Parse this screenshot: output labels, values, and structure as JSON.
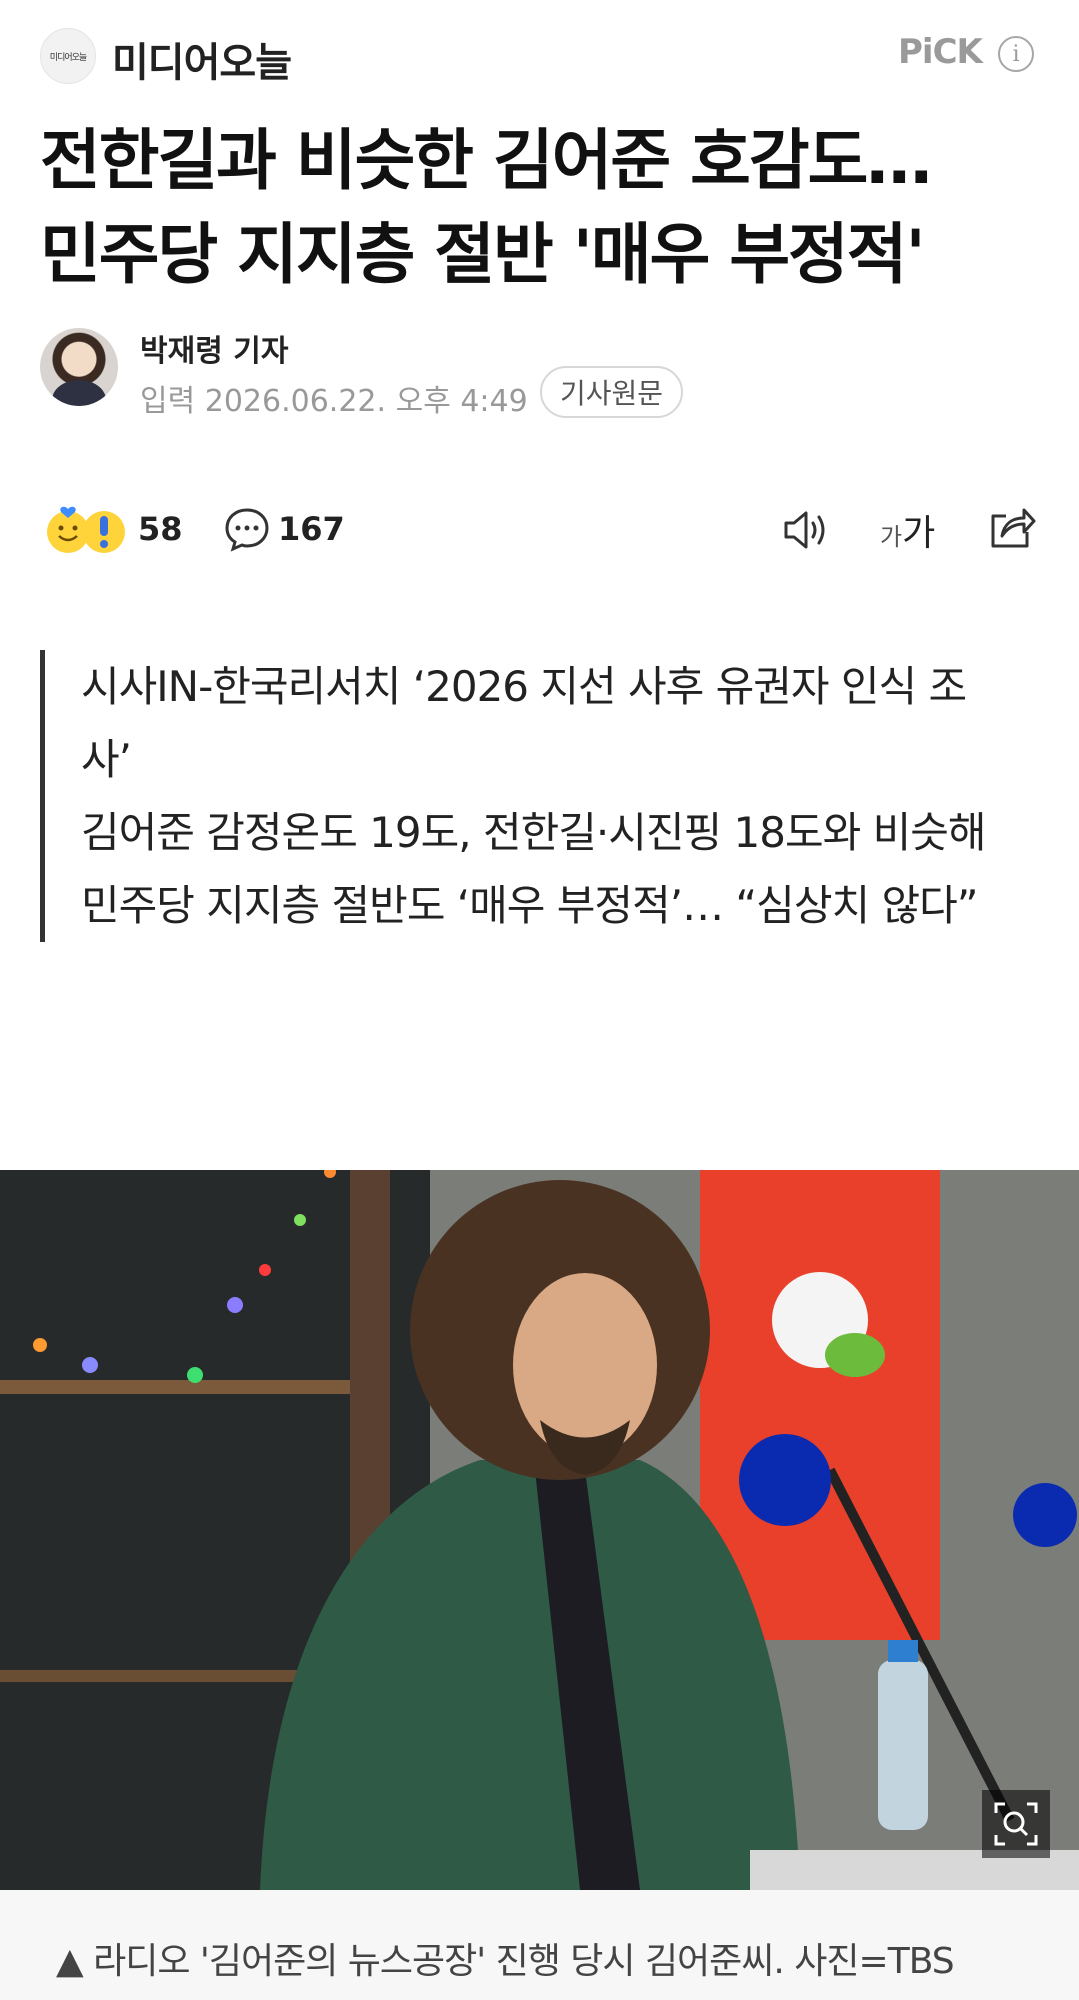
{
  "header": {
    "press_name": "미디어오늘",
    "press_logo_text": "미디어오늘",
    "pick_label": "PiCK",
    "info_symbol": "i"
  },
  "article": {
    "headline_line1": "전한길과 비슷한 김어준 호감도…",
    "headline_line2": "민주당 지지층 절반 '매우 부정적'",
    "reporter": "박재령 기자",
    "date_label": "입력",
    "date": "2026.06.22. 오후 4:49",
    "origin_label": "기사원문"
  },
  "toolbar": {
    "reaction_count": "58",
    "comment_count": "167",
    "font_size_small": "가",
    "font_size_large": "가"
  },
  "summary": [
    "시사IN-한국리서치 ‘2026 지선 사후 유권자 인식 조사’",
    "김어준 감정온도 19도, 전한길·시진핑 18도와 비슷해",
    "민주당 지지층 절반도 ‘매우 부정적’… “심상치 않다”"
  ],
  "photo": {
    "caption": "▲ 라디오 '김어준의 뉴스공장' 진행 당시 김어준씨. 사진=TBS"
  },
  "colors": {
    "mic": "#0a2bb0",
    "jacket": "#2f5a45",
    "banner": "#e8402a"
  }
}
